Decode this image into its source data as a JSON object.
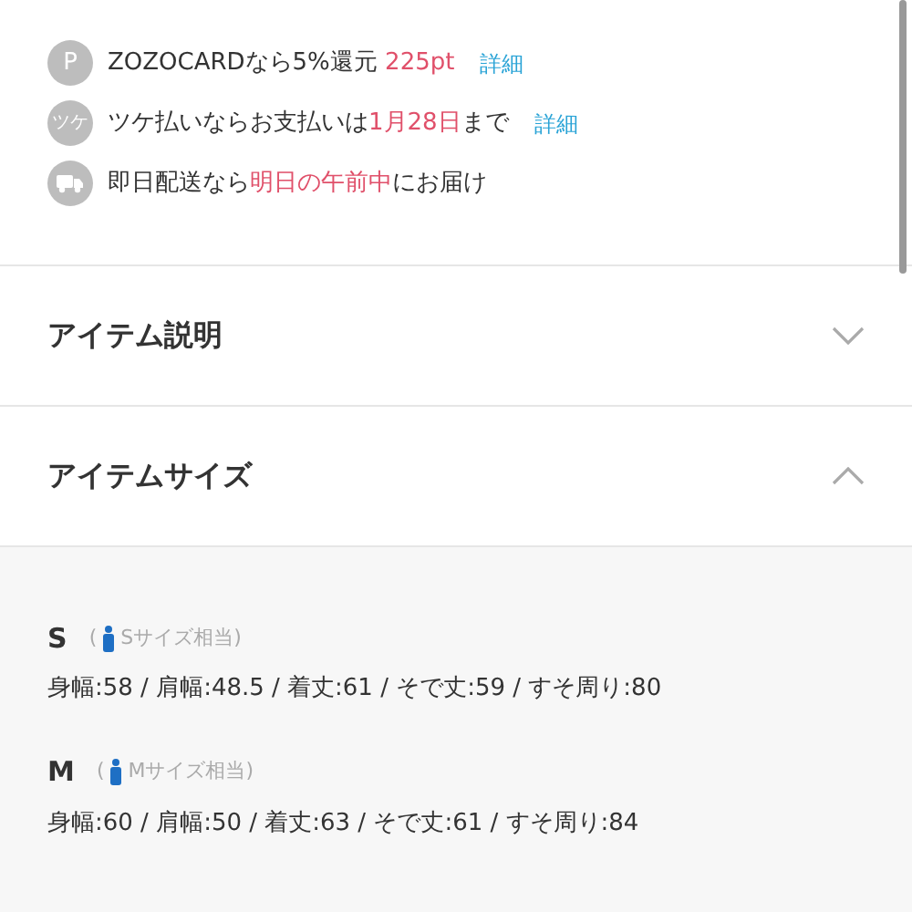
{
  "perks": [
    {
      "kind": "points",
      "badge": "P",
      "parts": [
        {
          "text": "ZOZOCARDなら5%還元 ",
          "highlight": false
        },
        {
          "text": "225pt",
          "highlight": true
        }
      ],
      "link": "詳細"
    },
    {
      "kind": "tsuke",
      "badge": "ツケ",
      "parts": [
        {
          "text": "ツケ払いならお支払いは",
          "highlight": false
        },
        {
          "text": "1月28日",
          "highlight": true
        },
        {
          "text": "まで",
          "highlight": false
        }
      ],
      "link": "詳細"
    },
    {
      "kind": "delivery",
      "parts": [
        {
          "text": "即日配送なら",
          "highlight": false
        },
        {
          "text": "明日の午前中",
          "highlight": true
        },
        {
          "text": "にお届け",
          "highlight": false
        }
      ]
    }
  ],
  "sections": [
    {
      "title": "アイテム説明",
      "expanded": false
    },
    {
      "title": "アイテムサイズ",
      "expanded": true
    }
  ],
  "sizes": [
    {
      "size": "S",
      "open": "(",
      "note": "Sサイズ相当)",
      "measurements": "身幅:58 / 肩幅:48.5 / 着丈:61 / そで丈:59 / すそ周り:80"
    },
    {
      "size": "M",
      "open": "(",
      "note": "Mサイズ相当)",
      "measurements": "身幅:60 / 肩幅:50 / 着丈:63 / そで丈:61 / すそ周り:84"
    }
  ]
}
